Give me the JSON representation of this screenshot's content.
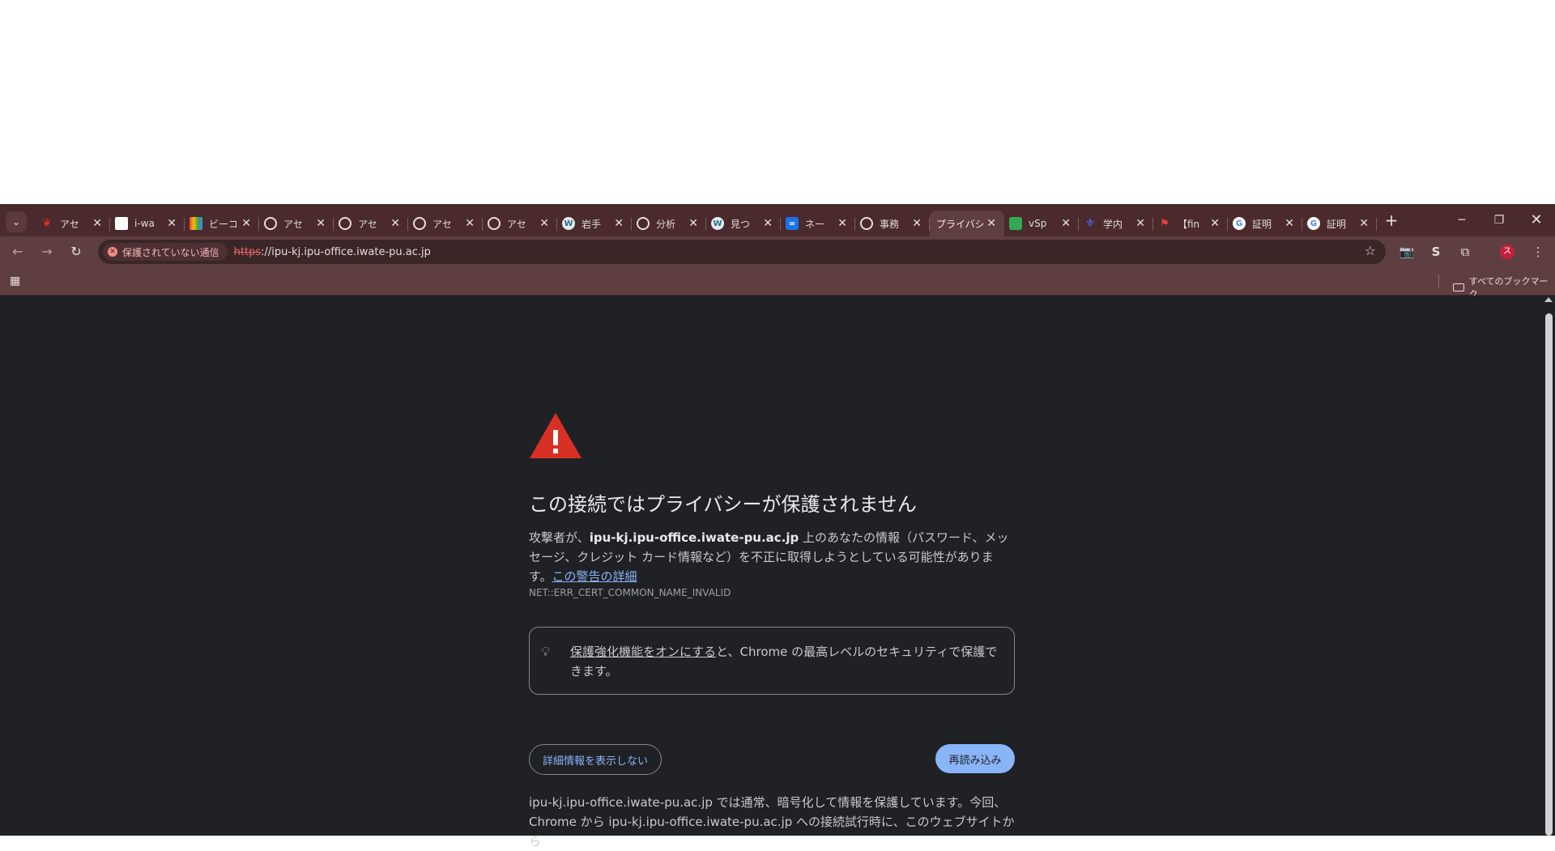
{
  "tabs": [
    {
      "title": "アセ",
      "icon": "maple-leaf-icon",
      "color": "#d93025"
    },
    {
      "title": "i-wa",
      "icon": "document-icon",
      "color": "#ffffff"
    },
    {
      "title": "ビーコ",
      "icon": "color-grid-icon",
      "color": "#f4b400"
    },
    {
      "title": "アセ",
      "icon": "globe-icon",
      "color": "#e8dcdc"
    },
    {
      "title": "アセ",
      "icon": "globe-icon",
      "color": "#e8dcdc"
    },
    {
      "title": "アセ",
      "icon": "globe-icon",
      "color": "#e8dcdc"
    },
    {
      "title": "アセ",
      "icon": "globe-icon",
      "color": "#e8dcdc"
    },
    {
      "title": "岩手",
      "icon": "wordpress-icon",
      "color": "#e8e8e8"
    },
    {
      "title": "分析",
      "icon": "globe-icon",
      "color": "#e8dcdc"
    },
    {
      "title": "見つ",
      "icon": "wordpress-icon",
      "color": "#e8e8e8"
    },
    {
      "title": "ネー",
      "icon": "infinity-icon",
      "color": "#1a73e8"
    },
    {
      "title": "事務",
      "icon": "globe-icon",
      "color": "#e8dcdc"
    },
    {
      "title": "プライバシ",
      "icon": "",
      "color": "",
      "active": true
    },
    {
      "title": "vSp",
      "icon": "puzzle-icon",
      "color": "#34a853"
    },
    {
      "title": "学内",
      "icon": "crest-icon",
      "color": "#4a6cf7"
    },
    {
      "title": "【fin",
      "icon": "pin-icon",
      "color": "#ea4335"
    },
    {
      "title": "証明",
      "icon": "google-icon",
      "color": "#ffffff"
    },
    {
      "title": "証明",
      "icon": "google-icon",
      "color": "#ffffff"
    }
  ],
  "toolbar": {
    "security_chip": "保護されていない通信",
    "url_scheme": "https",
    "url_rest": "://ipu-kj.ipu-office.iwate-pu.ac.jp",
    "avatar_letter": "ス"
  },
  "bookmarks": {
    "all_bookmarks": "すべてのブックマーク"
  },
  "interstitial": {
    "heading": "この接続ではプライバシーが保護されません",
    "desc_prefix": "攻撃者が、",
    "desc_host": "ipu-kj.ipu-office.iwate-pu.ac.jp",
    "desc_suffix": " 上のあなたの情報（パスワード、メッセージ、クレジット カード情報など）を不正に取得しようとしている可能性があります。",
    "desc_link": "この警告の詳細",
    "error_code": "NET::ERR_CERT_COMMON_NAME_INVALID",
    "tip_link": "保護強化機能をオンにする",
    "tip_rest": "と、Chrome の最高レベルのセキュリティで保護できます。",
    "details_button": "詳細情報を表示しない",
    "reload_button": "再読み込み",
    "detail_text": "ipu-kj.ipu-office.iwate-pu.ac.jp では通常、暗号化して情報を保護しています。今回、Chrome から ipu-kj.ipu-office.iwate-pu.ac.jp への接続試行時に、このウェブサイトから"
  },
  "colors": {
    "frame": "#4a2a2c",
    "toolbar": "#5f3e41",
    "page_bg": "#202124",
    "warning_red": "#d93025",
    "link_blue": "#8ab4f8"
  }
}
